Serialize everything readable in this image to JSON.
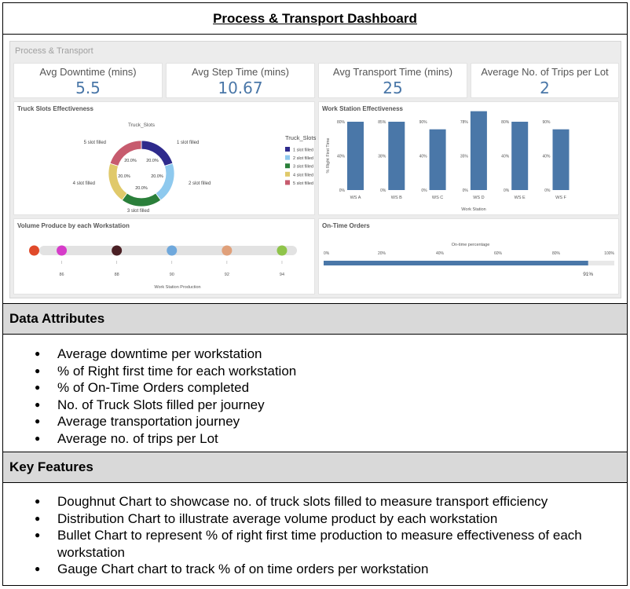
{
  "header": {
    "title": "Process & Transport Dashboard"
  },
  "dashboard": {
    "title": "Process & Transport",
    "kpis": [
      {
        "label": "Avg Downtime (mins)",
        "value": "5.5"
      },
      {
        "label": "Avg Step Time (mins)",
        "value": "10.67"
      },
      {
        "label": "Avg Transport Time (mins)",
        "value": "25"
      },
      {
        "label": "Average No. of Trips per Lot",
        "value": "2"
      }
    ]
  },
  "chart_data": [
    {
      "id": "truck-slots",
      "type": "pie",
      "title": "Truck Slots Effectiveness",
      "subtitle": "Truck_Slots",
      "legend_title": "Truck_Slots",
      "legend_position": "right",
      "categories": [
        "1 slot filled",
        "2 slot filled",
        "3 slot filled",
        "4 slot filled",
        "5 slot filled"
      ],
      "values": [
        20,
        20,
        20,
        20,
        20
      ],
      "value_labels": [
        "20.0%",
        "20.0%",
        "20.0%",
        "20.0%",
        "20.0%"
      ],
      "colors": [
        "#2e2a8c",
        "#8ec9ee",
        "#2a7f3a",
        "#e0c96a",
        "#c75b6e"
      ]
    },
    {
      "id": "ws-effectiveness",
      "type": "bar",
      "title": "Work Station Effectiveness",
      "xlabel": "Work Station",
      "ylabel": "% Right First Time",
      "categories": [
        "WS A",
        "WS B",
        "WS C",
        "WS D",
        "WS E",
        "WS F"
      ],
      "values": [
        80,
        85,
        80,
        90,
        80,
        80
      ],
      "ylim": [
        0,
        90
      ],
      "axes": [
        {
          "ticks": [
            "80%",
            "40%",
            "0%"
          ],
          "max": 80
        },
        {
          "ticks": [
            "85%",
            "38%",
            "0%"
          ],
          "max": 85
        },
        {
          "ticks": [
            "90%",
            "40%",
            "0%"
          ],
          "max": 90
        },
        {
          "ticks": [
            "78%",
            "35%",
            "0%"
          ],
          "max": 78
        },
        {
          "ticks": [
            "80%",
            "40%",
            "0%"
          ],
          "max": 80
        },
        {
          "ticks": [
            "90%",
            "40%",
            "0%"
          ],
          "max": 90
        }
      ],
      "color": "#4a77a8"
    },
    {
      "id": "volume",
      "type": "scatter",
      "title": "Volume Produce by each Workstation",
      "xlabel": "Work Station Production",
      "x": [
        85,
        86,
        88,
        90,
        92,
        94
      ],
      "xticks": [
        "86",
        "88",
        "90",
        "92",
        "94"
      ],
      "xlim": [
        84.9,
        94.6
      ],
      "colors": [
        "#e04a2a",
        "#d63cc9",
        "#4a1f24",
        "#6fa8dc",
        "#e0a07a",
        "#8fc44a"
      ]
    },
    {
      "id": "on-time",
      "type": "bar",
      "title": "On-Time Orders",
      "xlabel": "On-time percentage",
      "xticks": [
        "0%",
        "20%",
        "40%",
        "60%",
        "80%",
        "100%"
      ],
      "xlim": [
        0,
        100
      ],
      "values": [
        91
      ],
      "value_labels": [
        "91%"
      ],
      "color": "#4a77a8"
    }
  ],
  "data_attributes": {
    "heading": "Data Attributes",
    "items": [
      "Average downtime per workstation",
      "%  of Right first time for each workstation",
      "% of On-Time Orders completed",
      "No. of Truck Slots filled per journey",
      "Average transportation journey",
      "Average no. of trips per Lot"
    ]
  },
  "key_features": {
    "heading": "Key Features",
    "items": [
      "Doughnut Chart to showcase no. of truck slots filled to measure transport efficiency",
      "Distribution Chart to illustrate average volume product by each workstation",
      "Bullet Chart to represent % of right first time production to measure effectiveness of each workstation",
      "Gauge Chart chart to track % of on time orders per workstation"
    ]
  }
}
